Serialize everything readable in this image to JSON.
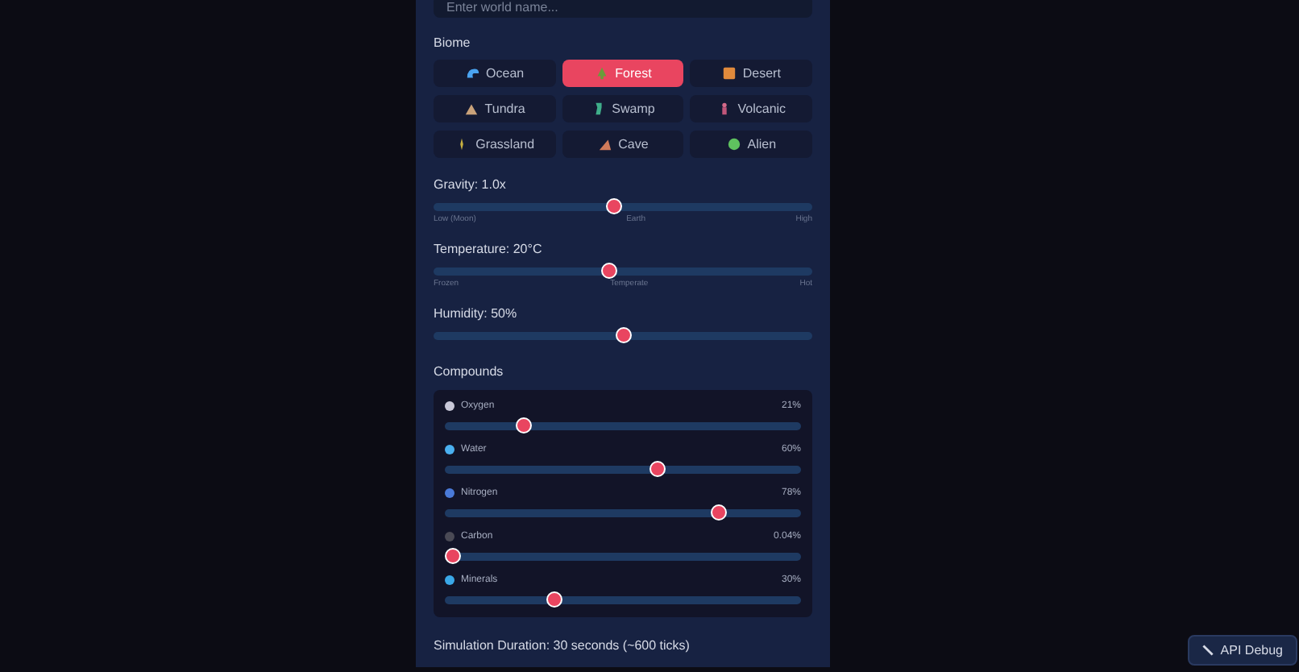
{
  "world_name": {
    "placeholder": "Enter world name..."
  },
  "biome": {
    "label": "Biome",
    "options": [
      {
        "label": "Ocean",
        "selected": false
      },
      {
        "label": "Forest",
        "selected": true
      },
      {
        "label": "Desert",
        "selected": false
      },
      {
        "label": "Tundra",
        "selected": false
      },
      {
        "label": "Swamp",
        "selected": false
      },
      {
        "label": "Volcanic",
        "selected": false
      },
      {
        "label": "Grassland",
        "selected": false
      },
      {
        "label": "Cave",
        "selected": false
      },
      {
        "label": "Alien",
        "selected": false
      }
    ]
  },
  "sliders": [
    {
      "label": "Gravity: 1.0x",
      "level": 0.476,
      "ticks": [
        "Low (Moon)",
        "Earth",
        "High"
      ]
    },
    {
      "label": "Temperature: 20°C",
      "level": 0.462,
      "ticks": [
        "Frozen",
        "Temperate",
        "Hot"
      ]
    },
    {
      "label": "Humidity: 50%",
      "level": 0.5
    }
  ],
  "compounds": {
    "label": "Compounds",
    "items": [
      {
        "name": "Oxygen",
        "reading": "21%",
        "level": 0.21
      },
      {
        "name": "Water",
        "reading": "60%",
        "level": 0.6
      },
      {
        "name": "Nitrogen",
        "reading": "78%",
        "level": 0.78
      },
      {
        "name": "Carbon",
        "reading": "0.04%",
        "level": 0.0004
      },
      {
        "name": "Minerals",
        "reading": "30%",
        "level": 0.3
      }
    ]
  },
  "duration": {
    "label": "Simulation Duration: 30 seconds (~600 ticks)"
  },
  "debug_button": {
    "label": "API Debug"
  }
}
